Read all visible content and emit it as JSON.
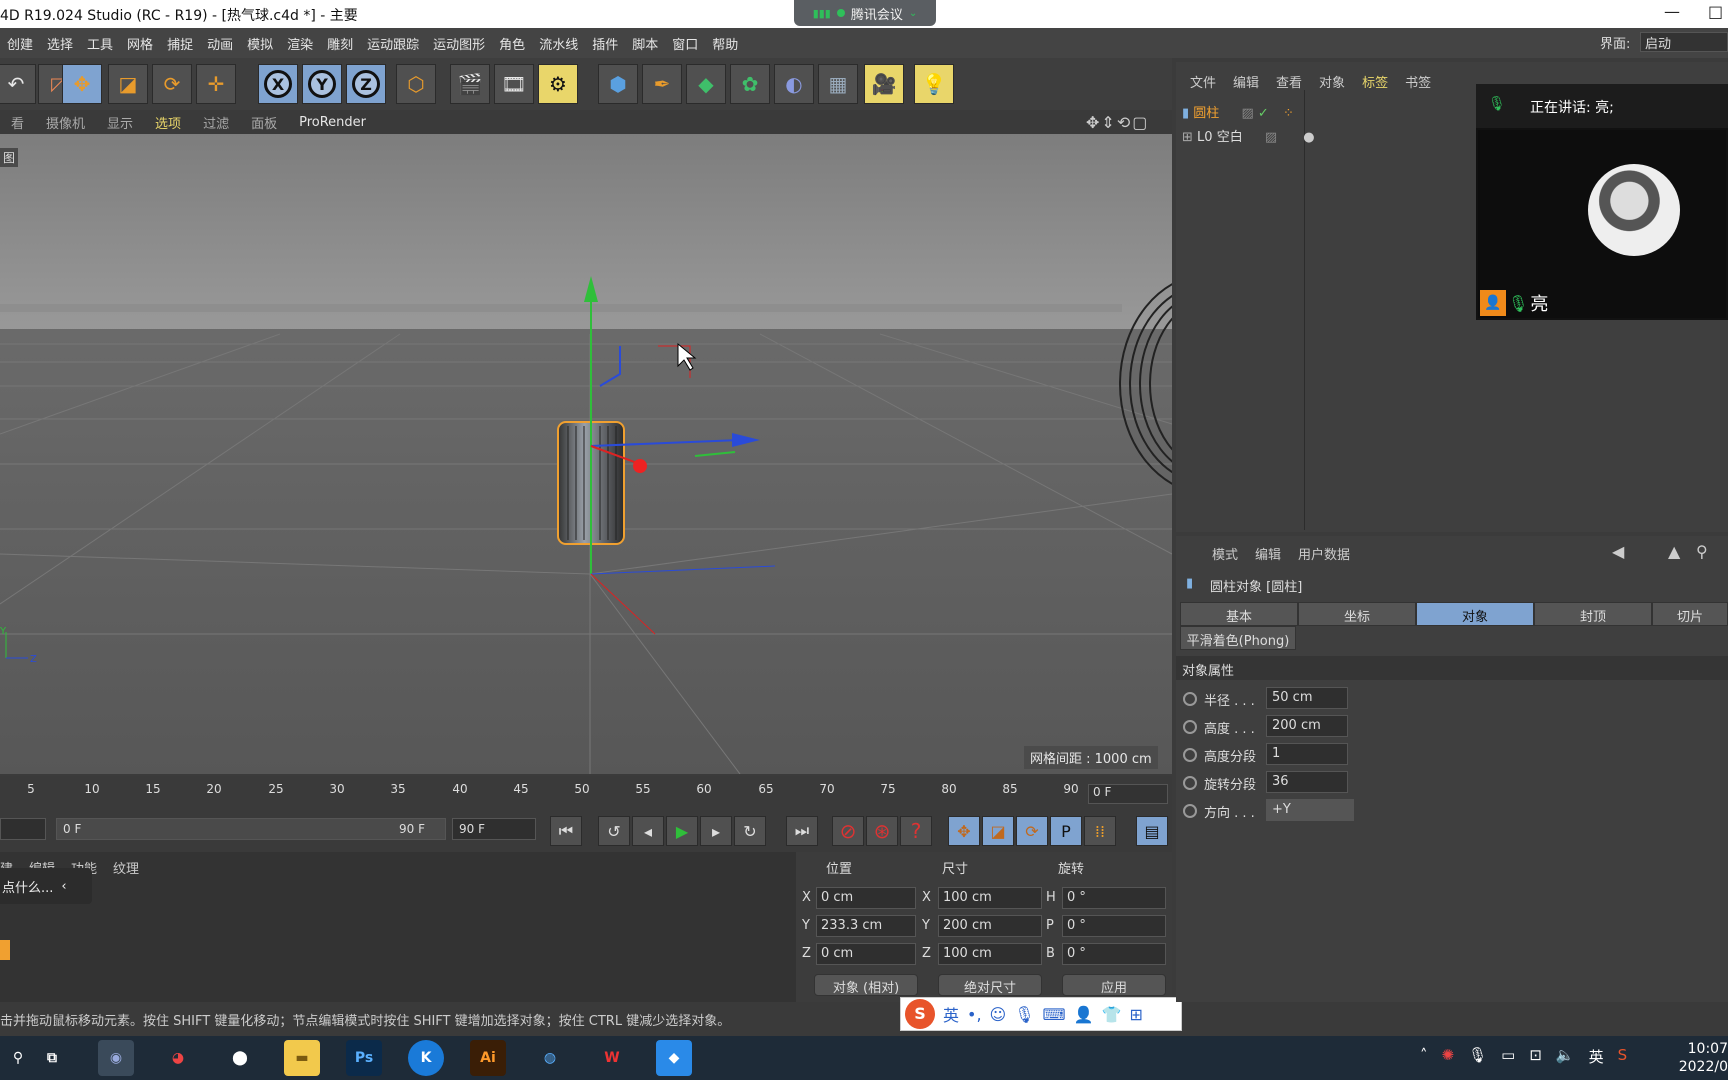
{
  "window": {
    "title": "4D R19.024 Studio (RC - R19) - [热气球.c4d *] - 主要",
    "controls": [
      "—",
      "□"
    ]
  },
  "meeting": {
    "label": "腾讯会议"
  },
  "menubar": {
    "items": [
      "创建",
      "选择",
      "工具",
      "网格",
      "捕捉",
      "动画",
      "模拟",
      "渲染",
      "雕刻",
      "运动跟踪",
      "运动图形",
      "角色",
      "流水线",
      "插件",
      "脚本",
      "窗口",
      "帮助"
    ],
    "layout_label": "界面:",
    "layout_value": "启动"
  },
  "toolbar": {
    "axis_x": "X",
    "axis_y": "Y",
    "axis_z": "Z"
  },
  "viewport_menu": {
    "items": [
      "看",
      "摄像机",
      "显示",
      "选项",
      "过滤",
      "面板",
      "ProRender"
    ],
    "active": "选项",
    "tag": "图",
    "grid_spacing": "网格间距 : 1000 cm",
    "nav_icons": "✥⇕⟲▢"
  },
  "timeline": {
    "ticks": [
      "5",
      "10",
      "15",
      "20",
      "25",
      "30",
      "35",
      "40",
      "45",
      "50",
      "55",
      "60",
      "65",
      "70",
      "75",
      "80",
      "85",
      "90"
    ],
    "current_frame": "0 F",
    "range_start": "0 F",
    "range_end": "90 F",
    "end_field": "90 F"
  },
  "material": {
    "menu": [
      "建",
      "编辑",
      "功能",
      "纹理"
    ],
    "popup": "点什么..."
  },
  "coordinates": {
    "headers": [
      "位置",
      "尺寸",
      "旋转"
    ],
    "position": {
      "x": "0 cm",
      "y": "233.3 cm",
      "z": "0 cm"
    },
    "size": {
      "x": "100 cm",
      "y": "200 cm",
      "z": "100 cm"
    },
    "rotation": {
      "h": "0 °",
      "p": "0 °",
      "b": "0 °"
    },
    "axis_labels": {
      "x": "X",
      "y": "Y",
      "z": "Z",
      "h": "H",
      "p": "P",
      "b": "B"
    },
    "mode": "对象 (相对)",
    "size_mode": "绝对尺寸",
    "apply": "应用"
  },
  "status": {
    "text": "击并拖动鼠标移动元素。按住 SHIFT 键量化移动；节点编辑模式时按住 SHIFT 键增加选择对象；按住 CTRL 键减少选择对象。"
  },
  "ime": {
    "logo": "S",
    "mode": "英",
    "punct": "•,"
  },
  "object_manager": {
    "menu": [
      "文件",
      "编辑",
      "查看",
      "对象",
      "标签",
      "书签"
    ],
    "active": "标签",
    "objects": [
      {
        "name": "圆柱",
        "selected": true
      },
      {
        "name": "空白",
        "selected": false
      }
    ]
  },
  "attribute_manager": {
    "menu": [
      "模式",
      "编辑",
      "用户数据"
    ],
    "title": "圆柱对象 [圆柱]",
    "tabs": [
      "基本",
      "坐标",
      "对象",
      "封顶",
      "切片"
    ],
    "active_tab": "对象",
    "phong_tab": "平滑着色(Phong)",
    "section": "对象属性",
    "props": [
      {
        "label": "半径 . . .",
        "value": "50 cm"
      },
      {
        "label": "高度 . . .",
        "value": "200 cm"
      },
      {
        "label": "高度分段",
        "value": "1"
      },
      {
        "label": "旋转分段",
        "value": "36"
      },
      {
        "label": "方向 . . .",
        "value": "+Y"
      }
    ]
  },
  "video": {
    "speaking": "正在讲话: 亮;",
    "participant": "亮"
  },
  "taskbar": {
    "tray_lang": "英",
    "time": "10:07",
    "date": "2022/0"
  },
  "colors": {
    "accent_yellow": "#e9d66a",
    "accent_blue": "#7fa3d0",
    "selection_orange": "#f0a030"
  }
}
